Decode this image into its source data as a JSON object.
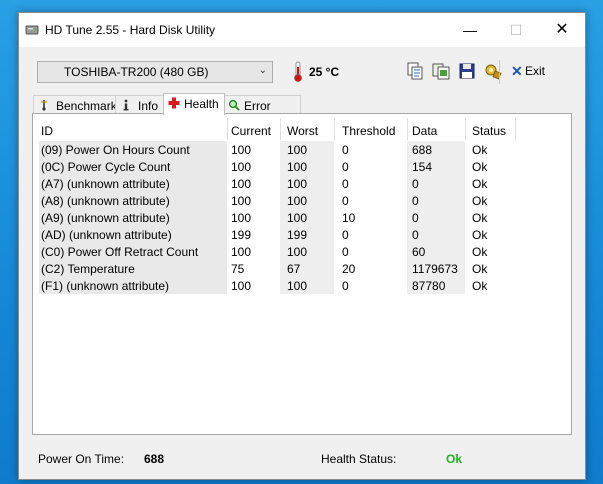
{
  "window": {
    "title": "HD Tune 2.55 - Hard Disk Utility"
  },
  "titlebar_buttons": {
    "minimize": "—",
    "maximize": "☐",
    "close": "✕"
  },
  "toolbar": {
    "drive": "TOSHIBA-TR200 (480 GB)",
    "temperature": "25 °C",
    "exit_mark": "✕",
    "exit_label": "Exit",
    "icons": [
      "copy-info-icon",
      "copy-screenshot-icon",
      "save-icon",
      "options-icon",
      "exit-icon"
    ]
  },
  "tabs": [
    {
      "label": "Benchmark",
      "icon": "benchmark-icon"
    },
    {
      "label": "Info",
      "icon": "info-icon"
    },
    {
      "label": "Health",
      "icon": "health-cross-icon",
      "active": true
    },
    {
      "label": "Error Scan",
      "icon": "magnifier-icon"
    }
  ],
  "table": {
    "columns": [
      "ID",
      "Current",
      "Worst",
      "Threshold",
      "Data",
      "Status"
    ],
    "rows": [
      {
        "id": "(09) Power On Hours Count",
        "current": "100",
        "worst": "100",
        "threshold": "0",
        "data": "688",
        "status": "Ok"
      },
      {
        "id": "(0C) Power Cycle Count",
        "current": "100",
        "worst": "100",
        "threshold": "0",
        "data": "154",
        "status": "Ok"
      },
      {
        "id": "(A7) (unknown attribute)",
        "current": "100",
        "worst": "100",
        "threshold": "0",
        "data": "0",
        "status": "Ok"
      },
      {
        "id": "(A8) (unknown attribute)",
        "current": "100",
        "worst": "100",
        "threshold": "0",
        "data": "0",
        "status": "Ok"
      },
      {
        "id": "(A9) (unknown attribute)",
        "current": "100",
        "worst": "100",
        "threshold": "10",
        "data": "0",
        "status": "Ok"
      },
      {
        "id": "(AD) (unknown attribute)",
        "current": "199",
        "worst": "199",
        "threshold": "0",
        "data": "0",
        "status": "Ok"
      },
      {
        "id": "(C0) Power Off Retract Count",
        "current": "100",
        "worst": "100",
        "threshold": "0",
        "data": "60",
        "status": "Ok"
      },
      {
        "id": "(C2) Temperature",
        "current": "75",
        "worst": "67",
        "threshold": "20",
        "data": "1179673",
        "status": "Ok"
      },
      {
        "id": "(F1) (unknown attribute)",
        "current": "100",
        "worst": "100",
        "threshold": "0",
        "data": "87780",
        "status": "Ok"
      }
    ]
  },
  "status": {
    "power_on_label": "Power On Time:",
    "power_on_value": "688",
    "health_label": "Health Status:",
    "health_value": "Ok",
    "health_color": "#1fb81f"
  }
}
